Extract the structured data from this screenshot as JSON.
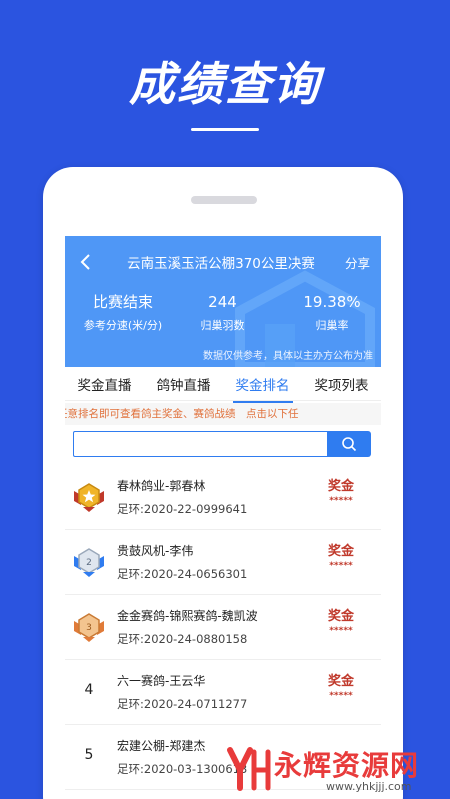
{
  "headline": "成绩查询",
  "race": {
    "title": "云南玉溪玉活公棚370公里决赛",
    "share": "分享",
    "stats": {
      "status_value": "比赛结束",
      "status_label": "参考分速(米/分)",
      "birds_value": "244",
      "birds_label": "归巢羽数",
      "rate_value": "19.38%",
      "rate_label": "归巢率"
    },
    "note": "数据仅供参考，具体以主办方公布为准"
  },
  "tabs": [
    {
      "label": "奖金直播"
    },
    {
      "label": "鸽钟直播"
    },
    {
      "label": "奖金排名"
    },
    {
      "label": "奖项列表"
    }
  ],
  "active_tab": "奖金排名",
  "notice": "任意排名即可查看鸽主奖金、赛鸽战绩　点击以下任",
  "search": {
    "placeholder": "",
    "value": ""
  },
  "rankings": [
    {
      "rank": "1",
      "name": "春林鸽业-郭春林",
      "ring": "足环:2020-22-0999641",
      "prize": "奖金",
      "stars": "*****",
      "badge": "gold"
    },
    {
      "rank": "2",
      "name": "贵鼓风机-李伟",
      "ring": "足环:2020-24-0656301",
      "prize": "奖金",
      "stars": "*****",
      "badge": "silver"
    },
    {
      "rank": "3",
      "name": "金金赛鸽-锦熙赛鸽-魏凯波",
      "ring": "足环:2020-24-0880158",
      "prize": "奖金",
      "stars": "*****",
      "badge": "bronze"
    },
    {
      "rank": "4",
      "name": "六一赛鸽-王云华",
      "ring": "足环:2020-24-0711277",
      "prize": "奖金",
      "stars": "*****",
      "badge": ""
    },
    {
      "rank": "5",
      "name": "宏建公棚-郑建杰",
      "ring": "足环:2020-03-1300613",
      "prize": "",
      "stars": "",
      "badge": ""
    }
  ],
  "watermark": {
    "text": "永辉资源网",
    "url": "www.yhkjjj.com"
  },
  "colors": {
    "background": "#2b54e0",
    "hero": "#4f97f6",
    "accent": "#2f7cf0",
    "prize": "#c0392b",
    "notice": "#e0703a"
  }
}
